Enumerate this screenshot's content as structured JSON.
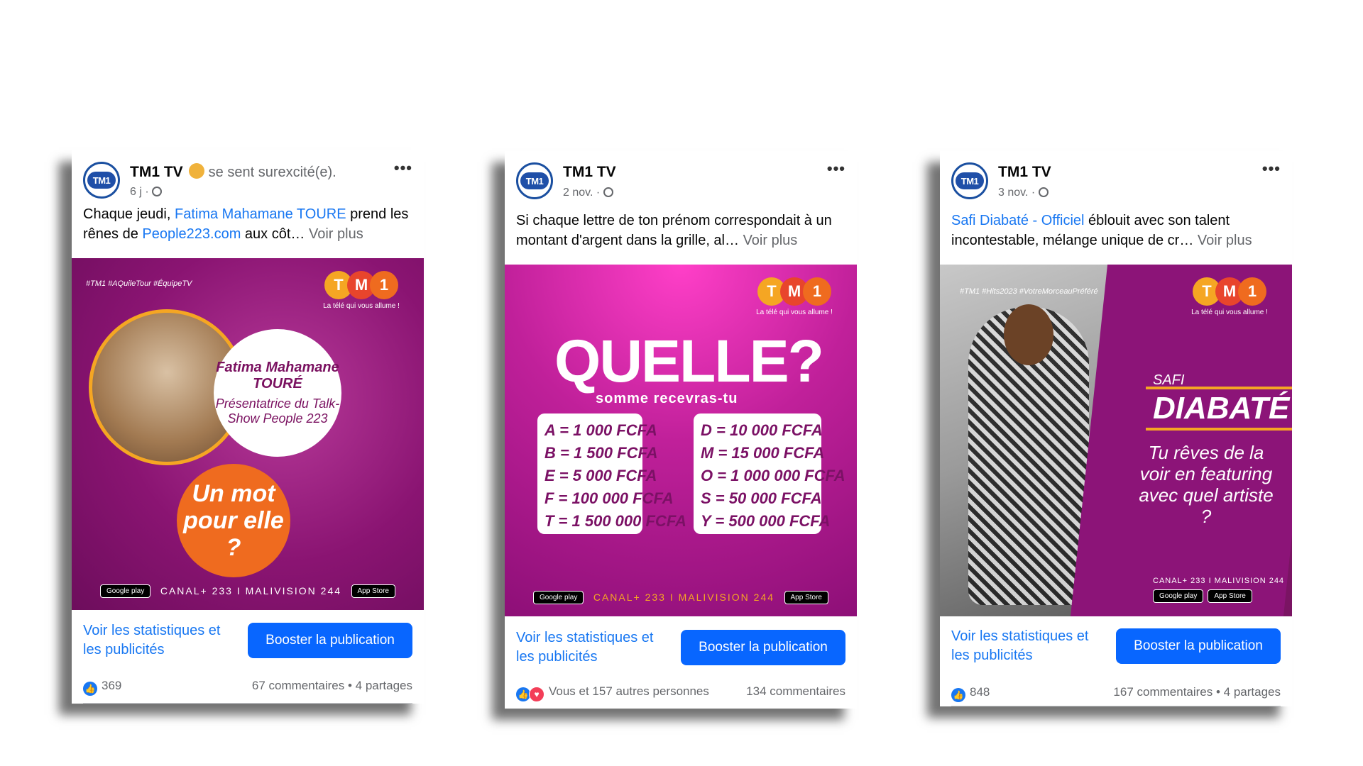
{
  "posts": [
    {
      "page_name": "TM1 TV",
      "feeling": "se sent surexcité(e).",
      "time": "6 j",
      "text": {
        "before": "Chaque jeudi, ",
        "link1": "Fatima Mahamane TOURE",
        "middle": " prend les rênes de ",
        "link2": "People223.com",
        "after": " aux côt… ",
        "more": "Voir plus"
      },
      "promo": {
        "hashtags": "#TM1 #AQuileTour #ÉquipeTV",
        "name_line1": "Fatima Mahamane",
        "name_line2": "TOURÉ",
        "role": "Présentatrice du Talk-Show People 223",
        "callout": "Un mot pour elle ?",
        "channels": "CANAL+ 233 I MALIVISION 244",
        "store_google": "Google play",
        "store_apple": "App Store"
      },
      "stats_link": "Voir les statistiques et les publicités",
      "boost": "Booster la publication",
      "reactions": "369",
      "comments_shares": "67 commentaires • 4 partages"
    },
    {
      "page_name": "TM1 TV",
      "time": "2 nov.",
      "text": {
        "body": "Si chaque lettre de ton prénom correspondait à un montant d'argent dans la grille, al… ",
        "more": "Voir plus"
      },
      "promo": {
        "headline": "QUELLE?",
        "subline": "somme recevras-tu",
        "left_grid": [
          "A = 1 000 FCFA",
          "B = 1 500 FCFA",
          "E = 5 000 FCFA",
          "F = 100 000 FCFA",
          "T = 1 500 000 FCFA"
        ],
        "right_grid": [
          "D = 10 000 FCFA",
          "M = 15 000 FCFA",
          "O = 1 000 000 FCFA",
          "S = 50 000 FCFA",
          "Y = 500 000 FCFA"
        ],
        "channels": "CANAL+ 233 I MALIVISION 244",
        "store_google": "Google play",
        "store_apple": "App Store"
      },
      "stats_link": "Voir les statistiques et les publicités",
      "boost": "Booster la publication",
      "reactions": "Vous et 157 autres personnes",
      "comments_shares": "134 commentaires"
    },
    {
      "page_name": "TM1 TV",
      "time": "3 nov.",
      "text": {
        "link1": "Safi Diabaté - Officiel",
        "after": " éblouit avec son talent incontestable, mélange unique de cr… ",
        "more": "Voir plus"
      },
      "promo": {
        "hashtags": "#TM1 #Hits2023 #VotreMorceauPréféré",
        "first_name": "SAFI",
        "last_name": "DIABATÉ",
        "question": "Tu rêves de la voir en featuring avec quel artiste ?",
        "channels": "CANAL+ 233 I MALIVISION 244",
        "store_google": "Google play",
        "store_apple": "App Store"
      },
      "stats_link": "Voir les statistiques et les publicités",
      "boost": "Booster la publication",
      "reactions": "848",
      "comments_shares": "167 commentaires • 4 partages"
    }
  ],
  "logo": {
    "letters": [
      "T",
      "M",
      "1"
    ],
    "tagline": "La télé qui vous allume !",
    "avatar_text": "TM1"
  },
  "colors": {
    "facebook_blue": "#1877f2",
    "boost_button": "#0866ff",
    "promo_magenta": "#8e1476",
    "accent_orange": "#ef6b1f"
  }
}
